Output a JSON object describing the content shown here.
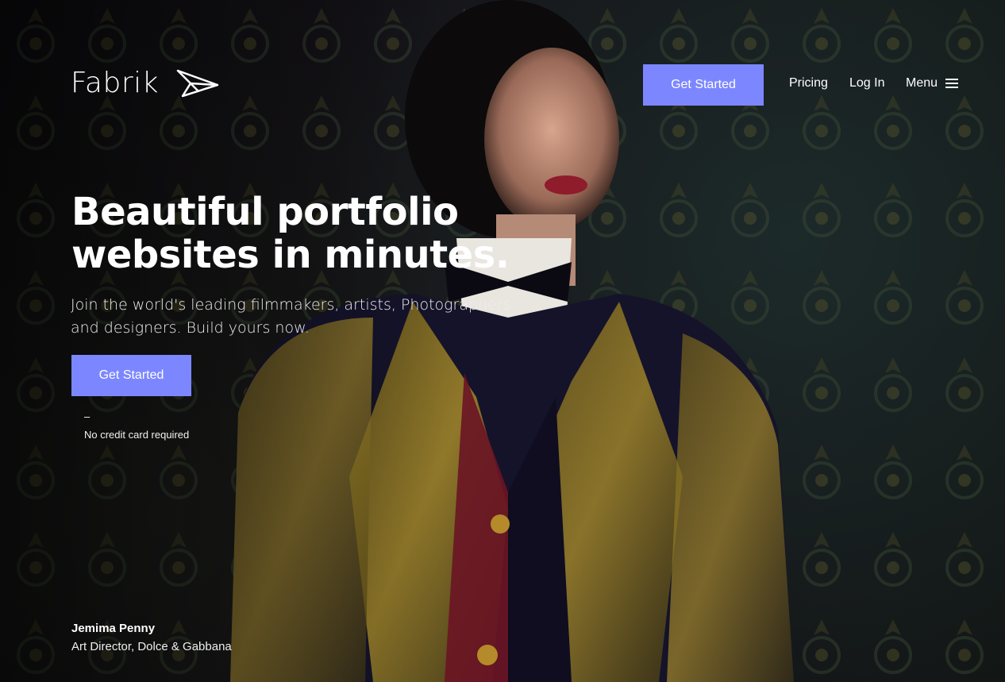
{
  "brand": {
    "name": "Fabrik",
    "logo_icon": "paper-plane-icon"
  },
  "nav": {
    "cta_label": "Get Started",
    "links": [
      "Pricing",
      "Log In"
    ],
    "menu_label": "Menu",
    "menu_icon": "hamburger-icon"
  },
  "hero": {
    "headline_line1": "Beautiful portfolio",
    "headline_line2": "websites in minutes.",
    "subtext": "Join the world's leading filmmakers, artists, Photographers and designers. Build yours now.",
    "cta_label": "Get Started",
    "dash": "–",
    "note": "No credit card required"
  },
  "credit": {
    "name": "Jemima Penny",
    "role": "Art Director, Dolce & Gabbana"
  },
  "colors": {
    "accent": "#7c87ff",
    "text": "#ffffff"
  }
}
